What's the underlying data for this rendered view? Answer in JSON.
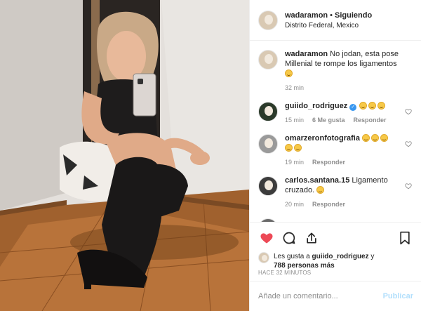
{
  "post": {
    "username": "wadaramon",
    "separator": "•",
    "follow_state": "Siguiendo",
    "location": "Distrito Federal, Mexico"
  },
  "comments": [
    {
      "user": "wadaramon",
      "text": "No jodan, esta pose Millenial te rompe los ligamentos",
      "emoji_count": 1,
      "time": "32 min",
      "likes": "",
      "reply": "",
      "verified": false
    },
    {
      "user": "guiido_rodriguez",
      "text": "",
      "emoji_count": 3,
      "time": "15 min",
      "likes": "6 Me gusta",
      "reply": "Responder",
      "verified": true
    },
    {
      "user": "omarzeronfotografia",
      "text": "",
      "emoji_count": 5,
      "time": "19 min",
      "likes": "",
      "reply": "Responder",
      "verified": false
    },
    {
      "user": "carlos.santana.15",
      "text": "Ligamento cruzado.",
      "emoji_count": 1,
      "time": "20 min",
      "likes": "",
      "reply": "Responder",
      "verified": false
    }
  ],
  "actions": {
    "like_icon": "heart-icon",
    "comment_icon": "comment-icon",
    "share_icon": "share-icon",
    "save_icon": "bookmark-icon",
    "like_color": "#ed4956"
  },
  "likes_summary": {
    "prefix": "Les gusta a",
    "user": "guiido_rodriguez",
    "connector": "y",
    "others": "788 personas más"
  },
  "timestamp": "HACE 32 MINUTOS",
  "add_comment": {
    "placeholder": "Añade un comentario...",
    "publish_label": "Publicar"
  }
}
